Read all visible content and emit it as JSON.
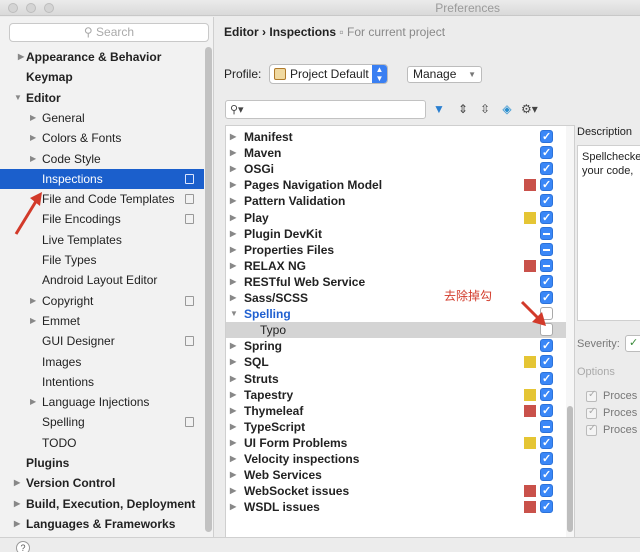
{
  "window": {
    "title": "Preferences"
  },
  "sidebar": {
    "search_placeholder": "Search",
    "items": [
      {
        "label": "Appearance & Behavior",
        "arrow": "▶"
      },
      {
        "label": "Keymap",
        "arrow": ""
      },
      {
        "label": "Editor",
        "arrow": "▼"
      },
      {
        "label": "General",
        "arrow": "▶"
      },
      {
        "label": "Colors & Fonts",
        "arrow": "▶"
      },
      {
        "label": "Code Style",
        "arrow": "▶"
      },
      {
        "label": "Inspections",
        "arrow": ""
      },
      {
        "label": "File and Code Templates",
        "arrow": ""
      },
      {
        "label": "File Encodings",
        "arrow": ""
      },
      {
        "label": "Live Templates",
        "arrow": ""
      },
      {
        "label": "File Types",
        "arrow": ""
      },
      {
        "label": "Android Layout Editor",
        "arrow": ""
      },
      {
        "label": "Copyright",
        "arrow": "▶"
      },
      {
        "label": "Emmet",
        "arrow": "▶"
      },
      {
        "label": "GUI Designer",
        "arrow": ""
      },
      {
        "label": "Images",
        "arrow": ""
      },
      {
        "label": "Intentions",
        "arrow": ""
      },
      {
        "label": "Language Injections",
        "arrow": "▶"
      },
      {
        "label": "Spelling",
        "arrow": ""
      },
      {
        "label": "TODO",
        "arrow": ""
      },
      {
        "label": "Plugins",
        "arrow": ""
      },
      {
        "label": "Version Control",
        "arrow": "▶"
      },
      {
        "label": "Build, Execution, Deployment",
        "arrow": "▶"
      },
      {
        "label": "Languages & Frameworks",
        "arrow": "▶"
      }
    ]
  },
  "main": {
    "breadcrumb_parent": "Editor",
    "breadcrumb_sep": "›",
    "breadcrumb_current": "Inspections",
    "breadcrumb_note": "For current project",
    "profile_label": "Profile:",
    "profile_value": "Project Default",
    "manage_label": "Manage",
    "filter_placeholder": ""
  },
  "inspections": [
    {
      "name": "Manifest",
      "arrow": "▶",
      "severity_color": "",
      "check": "on"
    },
    {
      "name": "Maven",
      "arrow": "▶",
      "severity_color": "",
      "check": "on"
    },
    {
      "name": "OSGi",
      "arrow": "▶",
      "severity_color": "",
      "check": "on"
    },
    {
      "name": "Pages Navigation Model",
      "arrow": "▶",
      "severity_color": "#c9514a",
      "check": "on"
    },
    {
      "name": "Pattern Validation",
      "arrow": "▶",
      "severity_color": "",
      "check": "on"
    },
    {
      "name": "Play",
      "arrow": "▶",
      "severity_color": "#e5c534",
      "check": "on"
    },
    {
      "name": "Plugin DevKit",
      "arrow": "▶",
      "severity_color": "",
      "check": "mixed"
    },
    {
      "name": "Properties Files",
      "arrow": "▶",
      "severity_color": "",
      "check": "mixed"
    },
    {
      "name": "RELAX NG",
      "arrow": "▶",
      "severity_color": "#c9514a",
      "check": "mixed"
    },
    {
      "name": "RESTful Web Service",
      "arrow": "▶",
      "severity_color": "",
      "check": "on"
    },
    {
      "name": "Sass/SCSS",
      "arrow": "▶",
      "severity_color": "",
      "check": "on"
    },
    {
      "name": "Spelling",
      "arrow": "▼",
      "severity_color": "",
      "check": "off"
    },
    {
      "name": "Typo",
      "arrow": "",
      "severity_color": "",
      "check": "off"
    },
    {
      "name": "Spring",
      "arrow": "▶",
      "severity_color": "",
      "check": "on"
    },
    {
      "name": "SQL",
      "arrow": "▶",
      "severity_color": "#e5c534",
      "check": "on"
    },
    {
      "name": "Struts",
      "arrow": "▶",
      "severity_color": "",
      "check": "on"
    },
    {
      "name": "Tapestry",
      "arrow": "▶",
      "severity_color": "#e5c534",
      "check": "on"
    },
    {
      "name": "Thymeleaf",
      "arrow": "▶",
      "severity_color": "#c9514a",
      "check": "on"
    },
    {
      "name": "TypeScript",
      "arrow": "▶",
      "severity_color": "",
      "check": "mixed"
    },
    {
      "name": "UI Form Problems",
      "arrow": "▶",
      "severity_color": "#e5c534",
      "check": "on"
    },
    {
      "name": "Velocity inspections",
      "arrow": "▶",
      "severity_color": "",
      "check": "on"
    },
    {
      "name": "Web Services",
      "arrow": "▶",
      "severity_color": "",
      "check": "on"
    },
    {
      "name": "WebSocket issues",
      "arrow": "▶",
      "severity_color": "#c9514a",
      "check": "on"
    },
    {
      "name": "WSDL issues",
      "arrow": "▶",
      "severity_color": "#c9514a",
      "check": "on"
    }
  ],
  "details": {
    "description_label": "Description",
    "description_text_1": "Spellchecke",
    "description_text_2": "your code,",
    "severity_label": "Severity:",
    "severity_value": "✓",
    "options_label": "Options",
    "options": [
      "Proces",
      "Proces",
      "Proces"
    ]
  },
  "annotation": {
    "text": "去除掉勾",
    "color": "#d23a2a"
  },
  "colors": {
    "selection": "#1b5fcc",
    "checkbox": "#3a87f7",
    "link": "#2060d0"
  }
}
